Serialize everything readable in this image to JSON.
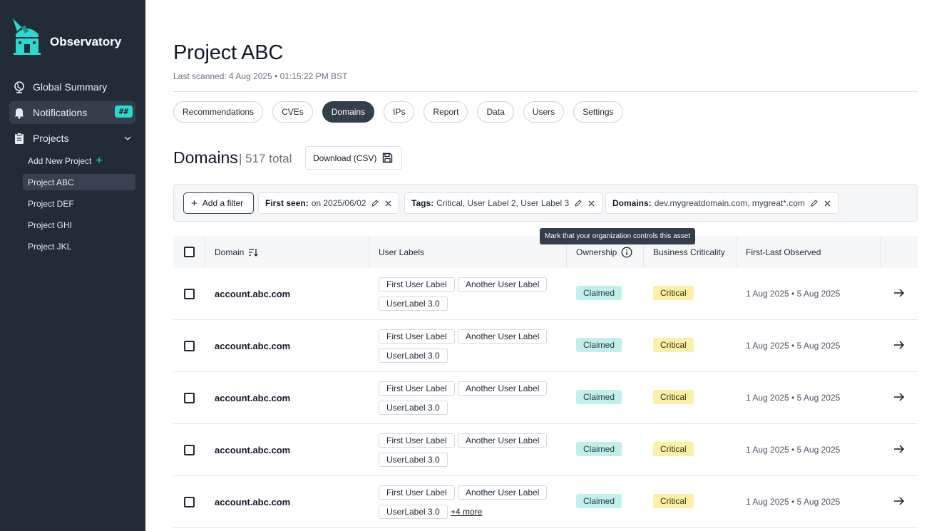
{
  "sidebar": {
    "brand": "Observatory",
    "nav": [
      {
        "label": "Global Summary",
        "icon": "globe-icon"
      },
      {
        "label": "Notifications",
        "icon": "bell-icon",
        "badge": "##"
      },
      {
        "label": "Projects",
        "icon": "clipboard-icon"
      }
    ],
    "add_project_label": "Add New Project",
    "projects": [
      "Project ABC",
      "Project DEF",
      "Project GHI",
      "Project JKL"
    ],
    "active_project": "Project ABC",
    "accent_color": "#2fd8cf"
  },
  "header": {
    "title": "Project ABC",
    "last_scanned": "Last scanned: 4 Aug 2025 • 01:15:22 PM BST"
  },
  "tabs": [
    "Recommendations",
    "CVEs",
    "Domains",
    "IPs",
    "Report",
    "Data",
    "Users",
    "Settings"
  ],
  "active_tab": "Domains",
  "section": {
    "title": "Domains",
    "count": "| 517 total",
    "download_label": "Download (CSV)"
  },
  "filters": {
    "add_label": "Add a filter",
    "chips": [
      {
        "key": "First seen:",
        "value": "on 2025/06/02"
      },
      {
        "key": "Tags:",
        "value": "Critical, User Label 2, User Label 3"
      },
      {
        "key": "Domains:",
        "value": "dev.mygreatdomain.com, mygreat*.com"
      }
    ]
  },
  "tooltip": "Mark that your organization controls this asset",
  "table": {
    "columns": [
      "Domain",
      "User Labels",
      "Ownership",
      "Business Criticality",
      "First-Last Observed"
    ],
    "rows": [
      {
        "domain": "account.abc.com",
        "labels": [
          "First User Label",
          "Another User Label",
          "UserLabel 3.0"
        ],
        "more": "",
        "ownership": "Claimed",
        "criticality": "Critical",
        "observed": "1 Aug 2025 • 5 Aug 2025"
      },
      {
        "domain": "account.abc.com",
        "labels": [
          "First User Label",
          "Another User Label",
          "UserLabel 3.0"
        ],
        "more": "",
        "ownership": "Claimed",
        "criticality": "Critical",
        "observed": "1 Aug 2025 • 5 Aug 2025"
      },
      {
        "domain": "account.abc.com",
        "labels": [
          "First User Label",
          "Another User Label",
          "UserLabel 3.0"
        ],
        "more": "",
        "ownership": "Claimed",
        "criticality": "Critical",
        "observed": "1 Aug 2025 • 5 Aug 2025"
      },
      {
        "domain": "account.abc.com",
        "labels": [
          "First User Label",
          "Another User Label",
          "UserLabel 3.0"
        ],
        "more": "",
        "ownership": "Claimed",
        "criticality": "Critical",
        "observed": "1 Aug 2025 • 5 Aug 2025"
      },
      {
        "domain": "account.abc.com",
        "labels": [
          "First User Label",
          "Another User Label",
          "UserLabel 3.0"
        ],
        "more": "+4 more",
        "ownership": "Claimed",
        "criticality": "Critical",
        "observed": "1 Aug 2025 • 5 Aug 2025"
      }
    ]
  }
}
